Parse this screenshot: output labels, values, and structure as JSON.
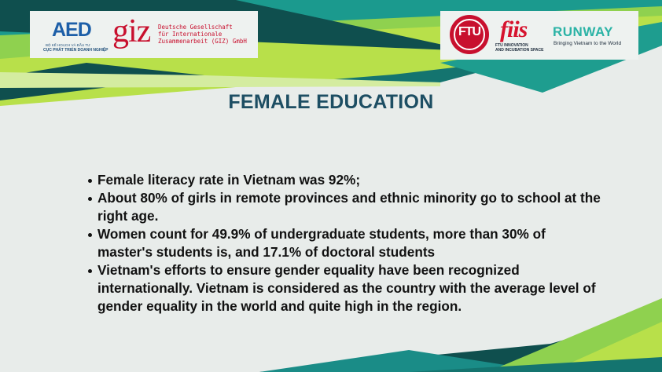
{
  "slide": {
    "title": "FEMALE EDUCATION",
    "bullets": [
      "Female literacy rate in Vietnam was 92%;",
      "About 80% of girls in remote provinces and ethnic minority  go to school at the right age.",
      "Women count for 49.9% of undergraduate students, more than 30% of master's students is, and 17.1% of doctoral students",
      "Vietnam's efforts to ensure gender equality have been recognized internationally. Vietnam is considered as the country with the average level of gender equality in the world and quite high in the region."
    ]
  },
  "logos": {
    "aed": {
      "mark": "AED",
      "line1": "BỘ KẾ HOẠCH VÀ ĐẦU TƯ",
      "line2": "CỤC PHÁT TRIỂN DOANH NGHIỆP"
    },
    "giz": {
      "mark": "giz",
      "line1": "Deutsche Gesellschaft",
      "line2": "für Internationale",
      "line3": "Zusammenarbeit (GIZ) GmbH"
    },
    "ftu": {
      "mark": "FTU"
    },
    "fiis": {
      "mark": "fiis",
      "line1": "FTU INNOVATION",
      "line2": "AND INCUBATION SPACE"
    },
    "runway": {
      "mark": "RUNWAY",
      "tagline": "Bringing Vietnam to the World"
    }
  },
  "colors": {
    "background": "#e8ecea",
    "title": "#1d4e63",
    "dark_teal": "#0f4f4e",
    "teal": "#1a8c87",
    "lime": "#b4df3a",
    "green": "#5dbb46"
  }
}
